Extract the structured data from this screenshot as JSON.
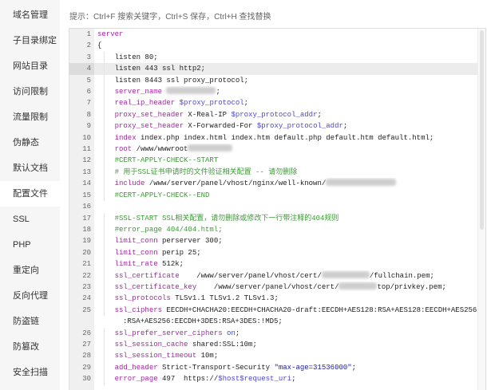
{
  "sidebar": {
    "items": [
      "域名管理",
      "子目录绑定",
      "网站目录",
      "访问限制",
      "流量限制",
      "伪静态",
      "默认文档",
      "配置文件",
      "SSL",
      "PHP",
      "重定向",
      "反向代理",
      "防盗链",
      "防篡改",
      "安全扫描"
    ],
    "active_index": 7
  },
  "hint": "提示：Ctrl+F 搜索关键字，Ctrl+S 保存，Ctrl+H 查找替换",
  "theme": {
    "keyword": "#a626a4",
    "variable": "#4f47d6",
    "string": "#1a1aa6",
    "constant": "#3d43e6",
    "comment": "#3a9a33"
  },
  "editor": {
    "active_line": 4,
    "lines": [
      {
        "n": 1,
        "indent": 0,
        "tokens": [
          {
            "type": "keyword",
            "text": "server"
          }
        ]
      },
      {
        "n": 2,
        "indent": 0,
        "tokens": [
          {
            "type": "plain",
            "text": "{"
          }
        ]
      },
      {
        "n": 3,
        "indent": 4,
        "tokens": [
          {
            "type": "plain",
            "text": "listen 80;"
          }
        ]
      },
      {
        "n": 4,
        "indent": 4,
        "tokens": [
          {
            "type": "plain",
            "text": "listen 443 ssl http2;"
          }
        ]
      },
      {
        "n": 5,
        "indent": 4,
        "tokens": [
          {
            "type": "plain",
            "text": "listen 8443 ssl proxy_protocol;"
          }
        ]
      },
      {
        "n": 6,
        "indent": 4,
        "tokens": [
          {
            "type": "keyword",
            "text": "server_name"
          },
          {
            "type": "plain",
            "text": " "
          },
          {
            "type": "redacted"
          },
          {
            "type": "plain",
            "text": ";"
          }
        ]
      },
      {
        "n": 7,
        "indent": 4,
        "tokens": [
          {
            "type": "keyword",
            "text": "real_ip_header"
          },
          {
            "type": "plain",
            "text": " "
          },
          {
            "type": "variable",
            "text": "$proxy_protocol"
          },
          {
            "type": "plain",
            "text": ";"
          }
        ]
      },
      {
        "n": 8,
        "indent": 4,
        "tokens": [
          {
            "type": "keyword",
            "text": "proxy_set_header"
          },
          {
            "type": "plain",
            "text": " X-Real-IP "
          },
          {
            "type": "variable",
            "text": "$proxy_protocol_addr"
          },
          {
            "type": "plain",
            "text": ";"
          }
        ]
      },
      {
        "n": 9,
        "indent": 4,
        "tokens": [
          {
            "type": "keyword",
            "text": "proxy_set_header"
          },
          {
            "type": "plain",
            "text": " X-Forwarded-For "
          },
          {
            "type": "variable",
            "text": "$proxy_protocol_addr"
          },
          {
            "type": "plain",
            "text": ";"
          }
        ]
      },
      {
        "n": 10,
        "indent": 4,
        "tokens": [
          {
            "type": "keyword",
            "text": "index"
          },
          {
            "type": "plain",
            "text": " index.php index.html index.htm default.php default.htm default.html;"
          }
        ]
      },
      {
        "n": 11,
        "indent": 4,
        "tokens": [
          {
            "type": "keyword",
            "text": "root"
          },
          {
            "type": "plain",
            "text": " /www/wwwroot"
          },
          {
            "type": "redacted"
          }
        ]
      },
      {
        "n": 12,
        "indent": 4,
        "tokens": [
          {
            "type": "comment",
            "text": "#CERT-APPLY-CHECK--START"
          }
        ]
      },
      {
        "n": 13,
        "indent": 4,
        "tokens": [
          {
            "type": "comment",
            "text": "# 用于SSL证书申请时的文件验证相关配置 -- 请勿删除"
          }
        ]
      },
      {
        "n": 14,
        "indent": 4,
        "tokens": [
          {
            "type": "keyword",
            "text": "include"
          },
          {
            "type": "plain",
            "text": " /www/server/panel/vhost/nginx/well-known/"
          },
          {
            "type": "redacted"
          }
        ]
      },
      {
        "n": 15,
        "indent": 4,
        "tokens": [
          {
            "type": "comment",
            "text": "#CERT-APPLY-CHECK--END"
          }
        ]
      },
      {
        "n": 16,
        "indent": 0,
        "tokens": []
      },
      {
        "n": 17,
        "indent": 4,
        "tokens": [
          {
            "type": "comment",
            "text": "#SSL-START SSL相关配置，请勿删除或修改下一行带注释的404规则"
          }
        ]
      },
      {
        "n": 18,
        "indent": 4,
        "tokens": [
          {
            "type": "comment",
            "text": "#error_page 404/404.html;"
          }
        ]
      },
      {
        "n": 19,
        "indent": 4,
        "tokens": [
          {
            "type": "keyword",
            "text": "limit_conn"
          },
          {
            "type": "plain",
            "text": " perserver 300;"
          }
        ]
      },
      {
        "n": 20,
        "indent": 4,
        "tokens": [
          {
            "type": "keyword",
            "text": "limit_conn"
          },
          {
            "type": "plain",
            "text": " perip 25;"
          }
        ]
      },
      {
        "n": 21,
        "indent": 4,
        "tokens": [
          {
            "type": "keyword",
            "text": "limit_rate"
          },
          {
            "type": "plain",
            "text": " 512k;"
          }
        ]
      },
      {
        "n": 22,
        "indent": 4,
        "tokens": [
          {
            "type": "keyword",
            "text": "ssl_certificate"
          },
          {
            "type": "plain",
            "text": "    /www/server/panel/vhost/cert/"
          },
          {
            "type": "redacted"
          },
          {
            "type": "plain",
            "text": "/fullchain.pem;"
          }
        ]
      },
      {
        "n": 23,
        "indent": 4,
        "tokens": [
          {
            "type": "keyword",
            "text": "ssl_certificate_key"
          },
          {
            "type": "plain",
            "text": "    /www/server/panel/vhost/cert/"
          },
          {
            "type": "redacted"
          },
          {
            "type": "plain",
            "text": "top/privkey.pem;"
          }
        ]
      },
      {
        "n": 24,
        "indent": 4,
        "tokens": [
          {
            "type": "keyword",
            "text": "ssl_protocols"
          },
          {
            "type": "plain",
            "text": " TLSv1.1 TLSv1.2 TLSv1.3;"
          }
        ]
      },
      {
        "n": 25,
        "indent": 4,
        "tokens": [
          {
            "type": "keyword",
            "text": "ssl_ciphers"
          },
          {
            "type": "plain",
            "text": " EECDH+CHACHA20:EECDH+CHACHA20-draft:EECDH+AES128:RSA+AES128:EECDH+AES256"
          }
        ],
        "wrapped": [
          {
            "type": "plain",
            "text": ":RSA+AES256:EECDH+3DES:RSA+3DES:!MD5;"
          }
        ]
      },
      {
        "n": 26,
        "indent": 4,
        "tokens": [
          {
            "type": "keyword",
            "text": "ssl_prefer_server_ciphers"
          },
          {
            "type": "plain",
            "text": " "
          },
          {
            "type": "constant",
            "text": "on"
          },
          {
            "type": "plain",
            "text": ";"
          }
        ]
      },
      {
        "n": 27,
        "indent": 4,
        "tokens": [
          {
            "type": "keyword",
            "text": "ssl_session_cache"
          },
          {
            "type": "plain",
            "text": " shared:SSL:10m;"
          }
        ]
      },
      {
        "n": 28,
        "indent": 4,
        "tokens": [
          {
            "type": "keyword",
            "text": "ssl_session_timeout"
          },
          {
            "type": "plain",
            "text": " 10m;"
          }
        ]
      },
      {
        "n": 29,
        "indent": 4,
        "tokens": [
          {
            "type": "keyword",
            "text": "add_header"
          },
          {
            "type": "plain",
            "text": " Strict-Transport-Security "
          },
          {
            "type": "string",
            "text": "\"max-age=31536000\""
          },
          {
            "type": "plain",
            "text": ";"
          }
        ]
      },
      {
        "n": 30,
        "indent": 4,
        "tokens": [
          {
            "type": "keyword",
            "text": "error_page"
          },
          {
            "type": "plain",
            "text": " 497  https://"
          },
          {
            "type": "variable",
            "text": "$host$request_uri"
          },
          {
            "type": "plain",
            "text": ";"
          }
        ]
      }
    ]
  }
}
